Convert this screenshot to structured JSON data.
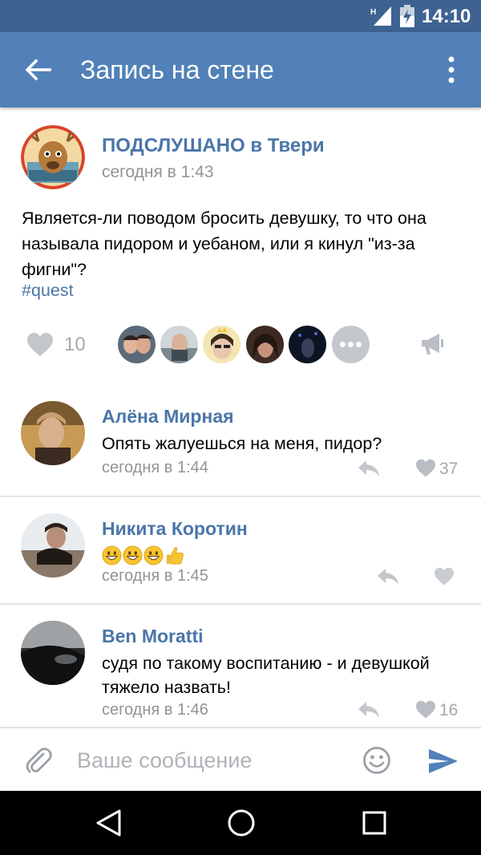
{
  "status_bar": {
    "network": "H",
    "time": "14:10"
  },
  "app_bar": {
    "title": "Запись на стене",
    "back_icon": "arrow-left-icon",
    "menu_icon": "more-vertical-icon"
  },
  "post": {
    "author": "ПОДСЛУШАНО в Твери",
    "time": "сегодня в 1:43",
    "text": "Является-ли поводом бросить девушку, то что она называла пидором и уебаном, или я кинул \"из-за фигни\"?",
    "hashtag": "#quest",
    "likes": "10"
  },
  "comments": [
    {
      "author": "Алёна Мирная",
      "text": "Опять жалуешься на меня, пидор?",
      "time": "сегодня в 1:44",
      "likes": "37"
    },
    {
      "author": "Никита Коротин",
      "text": "",
      "time": "сегодня в 1:45",
      "likes": ""
    },
    {
      "author": "Ben Moratti",
      "text": "судя по такому воспитанию - и девушкой тяжело назвать!",
      "time": "сегодня в 1:46",
      "likes": "16"
    }
  ],
  "composer": {
    "placeholder": "Ваше сообщение"
  },
  "colors": {
    "accent": "#5181b8",
    "status_bar": "#3e6291",
    "link": "#4a76a8",
    "secondary_text": "#939393"
  }
}
